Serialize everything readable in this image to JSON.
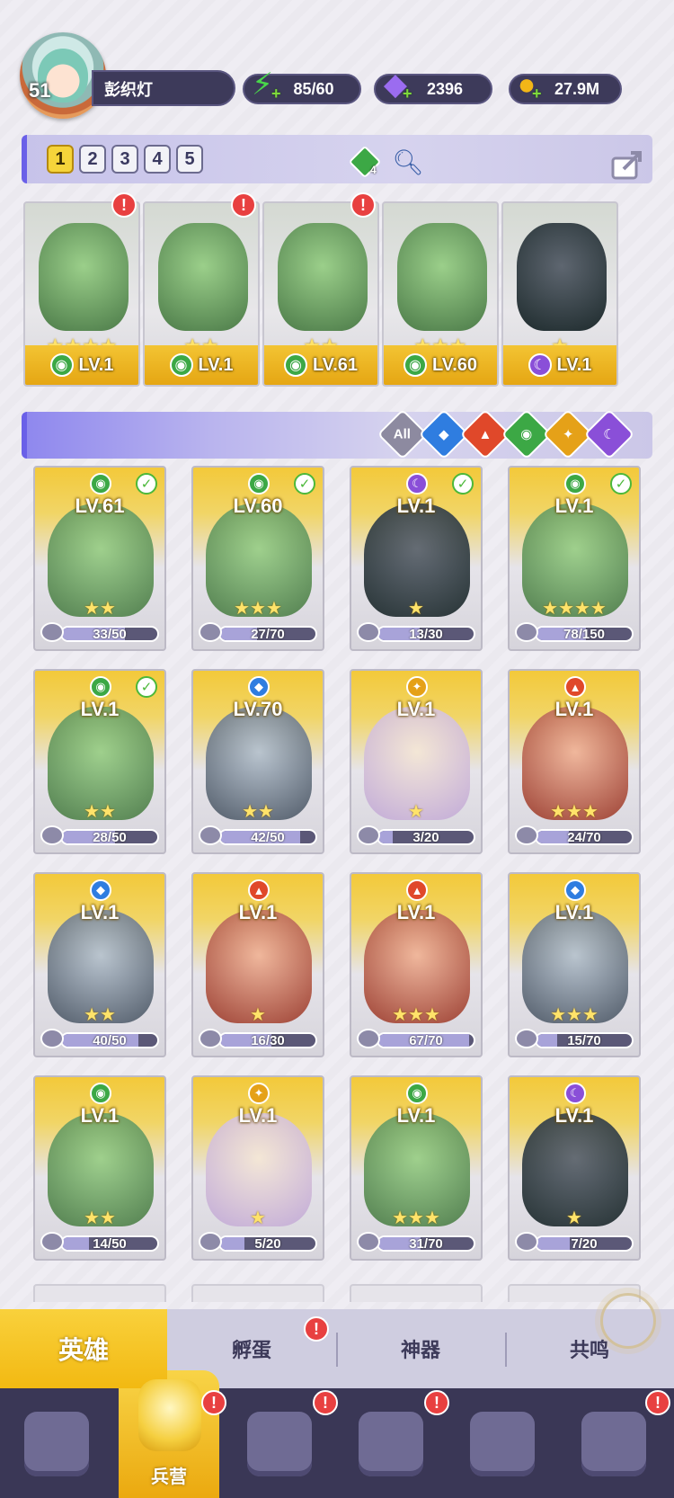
{
  "player": {
    "level": "51",
    "name": "彭织灯"
  },
  "resources": {
    "energy": {
      "value": "85/60",
      "icon": "lightning-icon",
      "color": "#49d64a"
    },
    "gems": {
      "value": "2396",
      "icon": "gem-icon",
      "color": "#9b6cf0"
    },
    "coins": {
      "value": "27.9M",
      "icon": "coin-icon",
      "color": "#f2b617"
    }
  },
  "team_tabs": [
    "1",
    "2",
    "3",
    "4",
    "5"
  ],
  "team_extra": {
    "badge_count": "4"
  },
  "team": [
    {
      "element": "nature",
      "stars": 4,
      "level": "LV.1",
      "alert": true
    },
    {
      "element": "nature",
      "stars": 2,
      "level": "LV.1",
      "alert": true
    },
    {
      "element": "nature",
      "stars": 2,
      "level": "LV.61",
      "alert": true
    },
    {
      "element": "nature",
      "stars": 3,
      "level": "LV.60",
      "alert": false
    },
    {
      "element": "dark",
      "stars": 1,
      "level": "LV.1",
      "alert": false
    }
  ],
  "filters": [
    {
      "label": "All",
      "color": "#8d8aa0"
    },
    {
      "label": "",
      "color": "#2f7de0",
      "icon": "water-icon"
    },
    {
      "label": "",
      "color": "#e0482a",
      "icon": "fire-icon"
    },
    {
      "label": "",
      "color": "#3ca845",
      "icon": "nature-icon"
    },
    {
      "label": "",
      "color": "#e5a118",
      "icon": "light-icon"
    },
    {
      "label": "",
      "color": "#8a4fd8",
      "icon": "dark-icon"
    }
  ],
  "elements": {
    "nature": {
      "color": "#3ca845",
      "glyph": "◉"
    },
    "dark": {
      "color": "#8a4fd8",
      "glyph": "☾"
    },
    "water": {
      "color": "#2f7de0",
      "glyph": "◆"
    },
    "fire": {
      "color": "#e0482a",
      "glyph": "▲"
    },
    "light": {
      "color": "#e5a118",
      "glyph": "✦"
    }
  },
  "heroes": [
    {
      "element": "nature",
      "level": "LV.61",
      "stars": 2,
      "progress": "33/50",
      "checked": true
    },
    {
      "element": "nature",
      "level": "LV.60",
      "stars": 3,
      "progress": "27/70",
      "checked": true
    },
    {
      "element": "dark",
      "level": "LV.1",
      "stars": 1,
      "progress": "13/30",
      "checked": true
    },
    {
      "element": "nature",
      "level": "LV.1",
      "stars": 4,
      "progress": "78/150",
      "checked": true
    },
    {
      "element": "nature",
      "level": "LV.1",
      "stars": 2,
      "progress": "28/50",
      "checked": true
    },
    {
      "element": "water",
      "level": "LV.70",
      "stars": 2,
      "progress": "42/50",
      "checked": false
    },
    {
      "element": "light",
      "level": "LV.1",
      "stars": 1,
      "progress": "3/20",
      "checked": false
    },
    {
      "element": "fire",
      "level": "LV.1",
      "stars": 3,
      "progress": "24/70",
      "checked": false
    },
    {
      "element": "water",
      "level": "LV.1",
      "stars": 2,
      "progress": "40/50",
      "checked": false
    },
    {
      "element": "fire",
      "level": "LV.1",
      "stars": 1,
      "progress": "16/30",
      "checked": false
    },
    {
      "element": "fire",
      "level": "LV.1",
      "stars": 3,
      "progress": "67/70",
      "checked": false
    },
    {
      "element": "water",
      "level": "LV.1",
      "stars": 3,
      "progress": "15/70",
      "checked": false
    },
    {
      "element": "nature",
      "level": "LV.1",
      "stars": 2,
      "progress": "14/50",
      "checked": false
    },
    {
      "element": "light",
      "level": "LV.1",
      "stars": 1,
      "progress": "5/20",
      "checked": false
    },
    {
      "element": "nature",
      "level": "LV.1",
      "stars": 3,
      "progress": "31/70",
      "checked": false
    },
    {
      "element": "dark",
      "level": "LV.1",
      "stars": 1,
      "progress": "7/20",
      "checked": false
    }
  ],
  "subtabs": [
    {
      "label": "英雄",
      "active": true,
      "alert": false
    },
    {
      "label": "孵蛋",
      "active": false,
      "alert": true
    },
    {
      "label": "神器",
      "active": false,
      "alert": false
    },
    {
      "label": "共鸣",
      "active": false,
      "alert": false
    }
  ],
  "nav": [
    {
      "icon": "cards-icon",
      "label": "",
      "active": false,
      "alert": false
    },
    {
      "icon": "barracks-icon",
      "label": "兵营",
      "active": true,
      "alert": true
    },
    {
      "icon": "map-icon",
      "label": "",
      "active": false,
      "alert": true
    },
    {
      "icon": "castle-icon",
      "label": "",
      "active": false,
      "alert": true
    },
    {
      "icon": "mushroom-icon",
      "label": "",
      "active": false,
      "alert": false
    },
    {
      "icon": "guild-banner-icon",
      "label": "",
      "active": false,
      "alert": true
    }
  ],
  "alert_symbol": "!",
  "check_symbol": "✓",
  "star_symbol": "★"
}
